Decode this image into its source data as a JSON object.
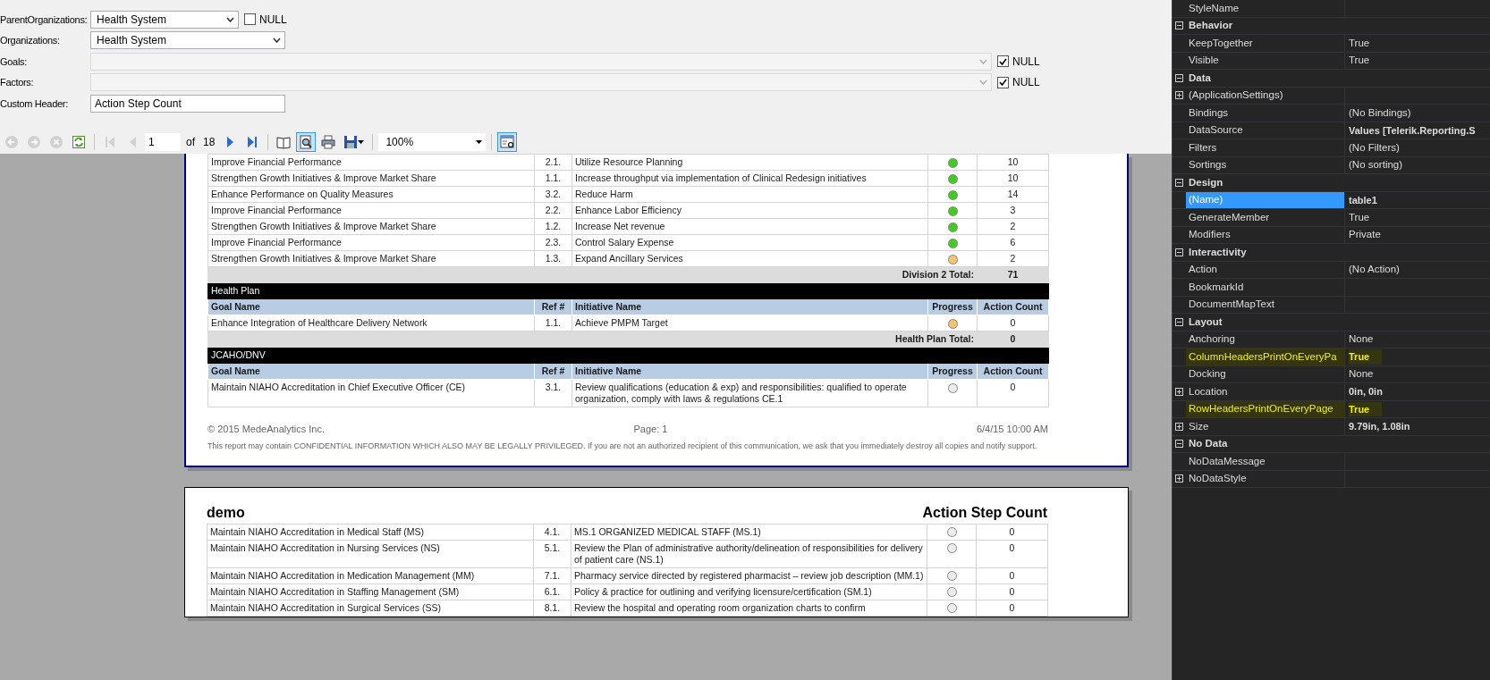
{
  "parameters": [
    {
      "label": "ParentOrganizations:",
      "kind": "select",
      "value": "Health System",
      "disabled": false,
      "null_option": {
        "label": "NULL",
        "checked": false
      }
    },
    {
      "label": "Organizations:",
      "kind": "select",
      "value": "Health System",
      "disabled": false
    },
    {
      "label": "Goals:",
      "kind": "select",
      "disabled": true,
      "null_option": {
        "label": "NULL",
        "checked": true
      }
    },
    {
      "label": "Factors:",
      "kind": "select",
      "disabled": true,
      "null_option": {
        "label": "NULL",
        "checked": true
      }
    },
    {
      "label": "Custom Header:",
      "kind": "text",
      "value": "Action Step Count",
      "disabled": false
    }
  ],
  "toolbar": [
    {
      "kind": "back",
      "enabled": false
    },
    {
      "kind": "forward",
      "enabled": false
    },
    {
      "kind": "stop",
      "enabled": false
    },
    {
      "kind": "refresh",
      "enabled": true
    },
    {
      "kind": "separator"
    },
    {
      "kind": "first",
      "enabled": false
    },
    {
      "kind": "previous",
      "enabled": false
    },
    {
      "kind": "page_input",
      "value": "1"
    },
    {
      "kind": "label",
      "text": "of"
    },
    {
      "kind": "label",
      "text": "18"
    },
    {
      "kind": "next",
      "enabled": true
    },
    {
      "kind": "last",
      "enabled": true
    },
    {
      "kind": "separator"
    },
    {
      "kind": "document_map",
      "enabled": true,
      "selected": false
    },
    {
      "kind": "print_preview",
      "enabled": true,
      "selected": true
    },
    {
      "kind": "print",
      "enabled": true,
      "selected": false
    },
    {
      "kind": "save",
      "enabled": true,
      "selected": false
    },
    {
      "kind": "separator"
    },
    {
      "kind": "zoom",
      "value": "100%"
    },
    {
      "kind": "separator"
    },
    {
      "kind": "toggle_view",
      "enabled": true,
      "selected": true
    }
  ],
  "report_page_1": {
    "groups": [
      {
        "rows": [
          {
            "goal": "Improve Financial Performance",
            "ref": "2.1.",
            "initiative": "Utilize Resource Planning",
            "color": "#3fcf1a",
            "count": "10"
          },
          {
            "goal": "Strengthen Growth Initiatives & Improve Market Share",
            "ref": "1.1.",
            "initiative": "Increase throughput via implementation of Clinical Redesign initiatives",
            "color": "#3fcf1a",
            "count": "10"
          },
          {
            "goal": "Enhance Performance on Quality Measures",
            "ref": "3.2.",
            "initiative": "Reduce Harm",
            "color": "#3fcf1a",
            "count": "14"
          },
          {
            "goal": "Improve Financial Performance",
            "ref": "2.2.",
            "initiative": "Enhance Labor Efficiency",
            "color": "#3fcf1a",
            "count": "3"
          },
          {
            "goal": "Strengthen Growth Initiatives & Improve Market Share",
            "ref": "1.2.",
            "initiative": "Increase Net revenue",
            "color": "#3fcf1a",
            "count": "2"
          },
          {
            "goal": "Improve Financial Performance",
            "ref": "2.3.",
            "initiative": "Control Salary Expense",
            "color": "#3fcf1a",
            "count": "6"
          },
          {
            "goal": "Strengthen Growth Initiatives & Improve Market Share",
            "ref": "1.3.",
            "initiative": "Expand Ancillary Services",
            "color": "#f6c46e",
            "count": "2"
          }
        ],
        "total": {
          "label": "Division 2 Total:",
          "value": "71"
        }
      },
      {
        "title": "Health Plan",
        "columns": [
          "Goal Name",
          "Ref #",
          "Initiative Name",
          "Progress",
          "Action Count"
        ],
        "rows": [
          {
            "goal": "Enhance Integration of Healthcare Delivery Network",
            "ref": "1.1.",
            "initiative": "Achieve PMPM Target",
            "color": "#f6c46e",
            "count": "0"
          }
        ],
        "total": {
          "label": "Health Plan Total:",
          "value": "0"
        }
      },
      {
        "title": "JCAHO/DNV",
        "columns": [
          "Goal Name",
          "Ref #",
          "Initiative Name",
          "Progress",
          "Action Count"
        ],
        "rows": [
          {
            "goal": "Maintain NIAHO Accreditation in Chief Executive Officer (CE)",
            "ref": "3.1.",
            "initiative": "Review qualifications (education & exp) and responsibilities: qualified to operate organization, comply with laws & regulations CE.1",
            "color": "#ececec",
            "count": "0"
          }
        ]
      }
    ],
    "footer": {
      "copyright": "© 2015 MedeAnalytics Inc.",
      "page": "Page: 1",
      "date": "6/4/15 10:00 AM",
      "disclaimer": "This report may contain CONFIDENTIAL INFORMATION WHICH ALSO MAY BE LEGALLY PRIVILEGED. If you are not an authorized recipient of this communication, we ask that you immediately destroy all copies and notify support."
    }
  },
  "report_page_2": {
    "title": "demo",
    "header": "Action Step Count",
    "rows": [
      {
        "goal": "Maintain NIAHO Accreditation in Medical Staff (MS)",
        "ref": "4.1.",
        "initiative": "MS.1 ORGANIZED MEDICAL STAFF (MS.1)",
        "color": "#ececec",
        "count": "0"
      },
      {
        "goal": "Maintain NIAHO Accreditation in Nursing Services (NS)",
        "ref": "5.1.",
        "initiative": "Review the Plan of administrative authority/delineation of responsibilities for delivery of patient care (NS.1)",
        "color": "#ececec",
        "count": "0"
      },
      {
        "goal": "Maintain NIAHO Accreditation in Medication Management (MM)",
        "ref": "7.1.",
        "initiative": "Pharmacy service directed by registered pharmacist – review job description (MM.1)",
        "color": "#ececec",
        "count": "0"
      },
      {
        "goal": "Maintain NIAHO Accreditation in Staffing Management (SM)",
        "ref": "6.1.",
        "initiative": "Policy & practice for outlining and verifying licensure/certification (SM.1)",
        "color": "#ececec",
        "count": "0"
      },
      {
        "goal": "Maintain NIAHO Accreditation in Surgical Services (SS)",
        "ref": "8.1.",
        "initiative": "Review the hospital and operating room organization charts to confirm",
        "color": "#ececec",
        "count": "0"
      }
    ]
  },
  "properties": {
    "categories": [
      {
        "properties": [
          {
            "name": "StyleName"
          }
        ]
      },
      {
        "name": "Behavior",
        "expanded": true,
        "properties": [
          {
            "name": "KeepTogether",
            "value": "True"
          },
          {
            "name": "Visible",
            "value": "True"
          }
        ]
      },
      {
        "name": "Data",
        "expanded": true,
        "properties": [
          {
            "name": "(ApplicationSettings)",
            "expanded": false
          },
          {
            "name": "Bindings",
            "value": "(No Bindings)"
          },
          {
            "name": "DataSource",
            "value": "Values [Telerik.Reporting.S",
            "bold": true
          },
          {
            "name": "Filters",
            "value": "(No Filters)"
          },
          {
            "name": "Sortings",
            "value": "(No sorting)"
          }
        ]
      },
      {
        "name": "Design",
        "expanded": true,
        "properties": [
          {
            "name": "(Name)",
            "value": "table1",
            "bold": true,
            "selected": true
          },
          {
            "name": "GenerateMember",
            "value": "True"
          },
          {
            "name": "Modifiers",
            "value": "Private"
          }
        ]
      },
      {
        "name": "Interactivity",
        "expanded": true,
        "properties": [
          {
            "name": "Action",
            "value": "(No Action)"
          },
          {
            "name": "BookmarkId"
          },
          {
            "name": "DocumentMapText"
          }
        ]
      },
      {
        "name": "Layout",
        "expanded": true,
        "properties": [
          {
            "name": "Anchoring",
            "value": "None"
          },
          {
            "name": "ColumnHeadersPrintOnEveryPa",
            "value": "True",
            "bold": true,
            "highlighted": true
          },
          {
            "name": "Docking",
            "value": "None"
          },
          {
            "name": "Location",
            "value": "0in, 0in",
            "bold": true,
            "expanded": false
          },
          {
            "name": "RowHeadersPrintOnEveryPage",
            "value": "True",
            "bold": true,
            "highlighted": true
          },
          {
            "name": "Size",
            "value": "9.79in, 1.08in",
            "bold": true,
            "expanded": false
          }
        ]
      },
      {
        "name": "No Data",
        "expanded": true,
        "properties": [
          {
            "name": "NoDataMessage"
          },
          {
            "name": "NoDataStyle",
            "expanded": false
          }
        ]
      }
    ]
  }
}
